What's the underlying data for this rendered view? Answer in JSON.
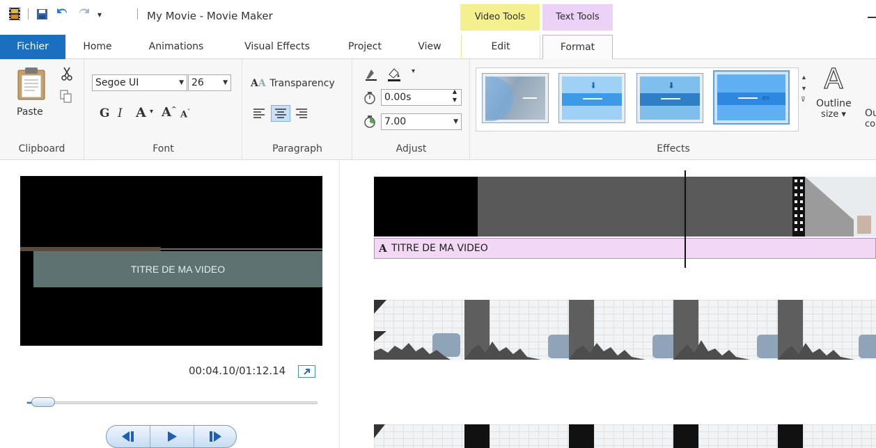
{
  "window": {
    "title": "My Movie - Movie Maker"
  },
  "contextual_tabs": {
    "video_tools": "Video Tools",
    "text_tools": "Text Tools"
  },
  "tabs": {
    "fichier": "Fichier",
    "home": "Home",
    "animations": "Animations",
    "visual_effects": "Visual Effects",
    "project": "Project",
    "view": "View",
    "edit": "Edit",
    "format": "Format"
  },
  "ribbon": {
    "clipboard": {
      "label": "Clipboard",
      "paste": "Paste"
    },
    "font": {
      "label": "Font",
      "family": "Segoe UI",
      "size": "26",
      "bold": "G",
      "italic": "I",
      "grow": "A",
      "shrink": "A"
    },
    "paragraph": {
      "label": "Paragraph",
      "transparency": "Transparency"
    },
    "adjust": {
      "label": "Adjust",
      "start_time": "0.00s",
      "duration": "7.00"
    },
    "effects": {
      "label": "Effects",
      "outline_size_line1": "Outline",
      "outline_size_line2": "size",
      "outline_color_line1": "Ou",
      "outline_color_line2": "co"
    }
  },
  "preview": {
    "overlay_text": "TITRE DE MA VIDEO",
    "timecode": "00:04.10/01:12.14",
    "progress": 0.057
  },
  "timeline": {
    "caption_text": "TITRE DE MA VIDEO",
    "caption_icon": "A"
  },
  "colors": {
    "accent_blue": "#1b6fc0",
    "video_tools": "#f5f08e",
    "text_tools": "#ebd2f6",
    "caption_bar": "#f3d8f6"
  }
}
